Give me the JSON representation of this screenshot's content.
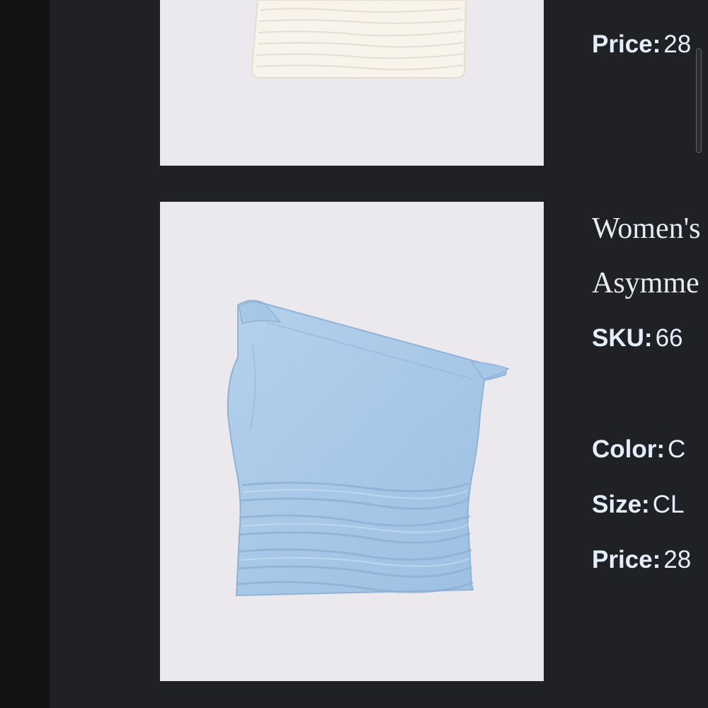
{
  "previous_item": {
    "image": "white-ruched-top-image",
    "price_label": "Price:",
    "price_value": "28"
  },
  "current_item": {
    "image": "light-blue-one-shoulder-top-image",
    "title_line_1": "Women's",
    "title_line_2": "Asymme",
    "sku_label": "SKU:",
    "sku_value": "66",
    "color_label": "Color:",
    "color_value": "C",
    "size_label": "Size:",
    "size_value": "CL",
    "price_label": "Price:",
    "price_value": "28"
  },
  "colors": {
    "background": "#202125",
    "image_background": "#ebe8ee",
    "top_fabric_blue": "#a9c8e6",
    "top_fabric_white": "#f8f4ec",
    "text": "#e5eefc"
  }
}
